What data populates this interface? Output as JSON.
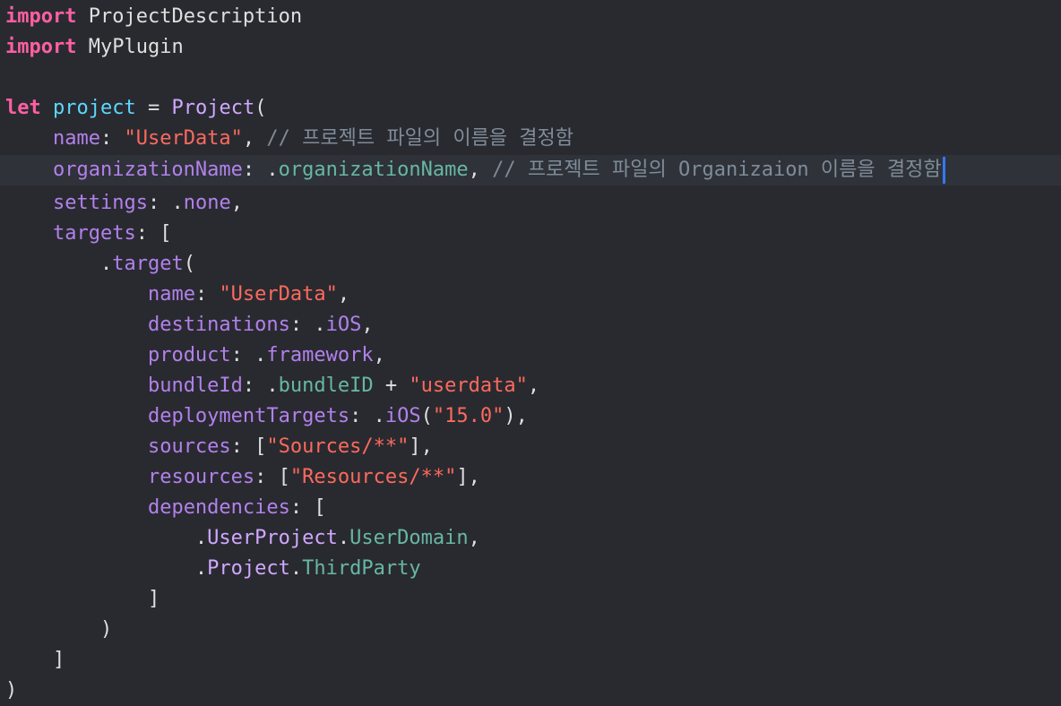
{
  "colors": {
    "background": "#292a30",
    "current_line": "#2f3239",
    "keyword": "#fc5fa3",
    "plain": "#dfdfe0",
    "declaration": "#5dd8ff",
    "property": "#b281eb",
    "string": "#fc6a5d",
    "comment": "#7f8c98",
    "project_type": "#d0a8ff",
    "project_member": "#67b7a4",
    "cursor": "#3478f6"
  },
  "current_line_index": 5,
  "lines": [
    [
      {
        "t": "kw",
        "v": "import"
      },
      {
        "t": "plain",
        "v": " ProjectDescription"
      }
    ],
    [
      {
        "t": "kw",
        "v": "import"
      },
      {
        "t": "plain",
        "v": " MyPlugin"
      }
    ],
    [],
    [
      {
        "t": "kw",
        "v": "let"
      },
      {
        "t": "plain",
        "v": " "
      },
      {
        "t": "decl",
        "v": "project"
      },
      {
        "t": "plain",
        "v": " = "
      },
      {
        "t": "proj-type",
        "v": "Project"
      },
      {
        "t": "plain",
        "v": "("
      }
    ],
    [
      {
        "t": "plain",
        "v": "    "
      },
      {
        "t": "prop",
        "v": "name"
      },
      {
        "t": "plain",
        "v": ": "
      },
      {
        "t": "str",
        "v": "\"UserData\""
      },
      {
        "t": "plain",
        "v": ", "
      },
      {
        "t": "comment",
        "v": "// 프로젝트 파일의 이름을 결정함"
      }
    ],
    [
      {
        "t": "plain",
        "v": "    "
      },
      {
        "t": "prop",
        "v": "organizationName"
      },
      {
        "t": "plain",
        "v": ": ."
      },
      {
        "t": "proj-member",
        "v": "organizationName"
      },
      {
        "t": "plain",
        "v": ", "
      },
      {
        "t": "comment",
        "v": "// 프로젝트 파일의 Organizaion 이름을 결정함"
      }
    ],
    [
      {
        "t": "plain",
        "v": "    "
      },
      {
        "t": "prop",
        "v": "settings"
      },
      {
        "t": "plain",
        "v": ": ."
      },
      {
        "t": "prop",
        "v": "none"
      },
      {
        "t": "plain",
        "v": ","
      }
    ],
    [
      {
        "t": "plain",
        "v": "    "
      },
      {
        "t": "prop",
        "v": "targets"
      },
      {
        "t": "plain",
        "v": ": ["
      }
    ],
    [
      {
        "t": "plain",
        "v": "        ."
      },
      {
        "t": "prop",
        "v": "target"
      },
      {
        "t": "plain",
        "v": "("
      }
    ],
    [
      {
        "t": "plain",
        "v": "            "
      },
      {
        "t": "prop",
        "v": "name"
      },
      {
        "t": "plain",
        "v": ": "
      },
      {
        "t": "str",
        "v": "\"UserData\""
      },
      {
        "t": "plain",
        "v": ","
      }
    ],
    [
      {
        "t": "plain",
        "v": "            "
      },
      {
        "t": "prop",
        "v": "destinations"
      },
      {
        "t": "plain",
        "v": ": ."
      },
      {
        "t": "prop",
        "v": "iOS"
      },
      {
        "t": "plain",
        "v": ","
      }
    ],
    [
      {
        "t": "plain",
        "v": "            "
      },
      {
        "t": "prop",
        "v": "product"
      },
      {
        "t": "plain",
        "v": ": ."
      },
      {
        "t": "prop",
        "v": "framework"
      },
      {
        "t": "plain",
        "v": ","
      }
    ],
    [
      {
        "t": "plain",
        "v": "            "
      },
      {
        "t": "prop",
        "v": "bundleId"
      },
      {
        "t": "plain",
        "v": ": ."
      },
      {
        "t": "proj-member",
        "v": "bundleID"
      },
      {
        "t": "plain",
        "v": " + "
      },
      {
        "t": "str",
        "v": "\"userdata\""
      },
      {
        "t": "plain",
        "v": ","
      }
    ],
    [
      {
        "t": "plain",
        "v": "            "
      },
      {
        "t": "prop",
        "v": "deploymentTargets"
      },
      {
        "t": "plain",
        "v": ": ."
      },
      {
        "t": "prop",
        "v": "iOS"
      },
      {
        "t": "plain",
        "v": "("
      },
      {
        "t": "str",
        "v": "\"15.0\""
      },
      {
        "t": "plain",
        "v": "),"
      }
    ],
    [
      {
        "t": "plain",
        "v": "            "
      },
      {
        "t": "prop",
        "v": "sources"
      },
      {
        "t": "plain",
        "v": ": ["
      },
      {
        "t": "str",
        "v": "\"Sources/**\""
      },
      {
        "t": "plain",
        "v": "],"
      }
    ],
    [
      {
        "t": "plain",
        "v": "            "
      },
      {
        "t": "prop",
        "v": "resources"
      },
      {
        "t": "plain",
        "v": ": ["
      },
      {
        "t": "str",
        "v": "\"Resources/**\""
      },
      {
        "t": "plain",
        "v": "],"
      }
    ],
    [
      {
        "t": "plain",
        "v": "            "
      },
      {
        "t": "prop",
        "v": "dependencies"
      },
      {
        "t": "plain",
        "v": ": ["
      }
    ],
    [
      {
        "t": "plain",
        "v": "                ."
      },
      {
        "t": "proj-type",
        "v": "UserProject"
      },
      {
        "t": "plain",
        "v": "."
      },
      {
        "t": "proj-member",
        "v": "UserDomain"
      },
      {
        "t": "plain",
        "v": ","
      }
    ],
    [
      {
        "t": "plain",
        "v": "                ."
      },
      {
        "t": "proj-type",
        "v": "Project"
      },
      {
        "t": "plain",
        "v": "."
      },
      {
        "t": "proj-member",
        "v": "ThirdParty"
      }
    ],
    [
      {
        "t": "plain",
        "v": "            ]"
      }
    ],
    [
      {
        "t": "plain",
        "v": "        )"
      }
    ],
    [
      {
        "t": "plain",
        "v": "    ]"
      }
    ],
    [
      {
        "t": "plain",
        "v": ")"
      }
    ]
  ]
}
